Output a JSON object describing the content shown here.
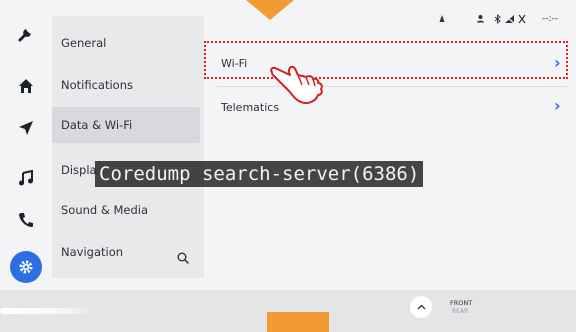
{
  "rail": {
    "icons": [
      "wrench-icon",
      "home-icon",
      "navigation-arrow-icon",
      "music-note-icon",
      "phone-icon",
      "gear-icon"
    ]
  },
  "menu": {
    "items": [
      {
        "label": "General"
      },
      {
        "label": "Notifications"
      },
      {
        "label": "Data & Wi-Fi",
        "selected": true
      },
      {
        "label": "Displa"
      },
      {
        "label": "Sound & Media"
      },
      {
        "label": "Navigation"
      }
    ]
  },
  "content": {
    "rows": [
      {
        "label": "Wi-Fi"
      },
      {
        "label": "Telematics"
      }
    ]
  },
  "status": {
    "time": "--:--"
  },
  "overlay": {
    "text": "Coredump search-server(6386)"
  },
  "bottom": {
    "seat_front": "FRONT",
    "seat_rear": "REAR"
  },
  "colors": {
    "accent": "#2d6fe0",
    "marker": "#f29a33",
    "highlight": "#e02020"
  }
}
